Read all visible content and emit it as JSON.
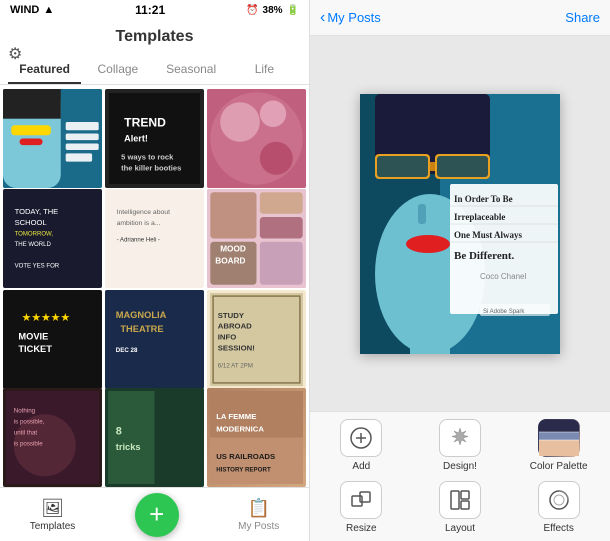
{
  "statusBar": {
    "carrier": "WIND",
    "wifi": true,
    "time": "11:21",
    "battery": "38%"
  },
  "leftPanel": {
    "title": "Templates",
    "tabs": [
      {
        "label": "Featured",
        "active": true
      },
      {
        "label": "Collage",
        "active": false
      },
      {
        "label": "Seasonal",
        "active": false
      },
      {
        "label": "Life",
        "active": false
      }
    ],
    "templates": [
      {
        "id": 1,
        "style": "t1",
        "text": ""
      },
      {
        "id": 2,
        "style": "t2",
        "text": "TREND Alert!"
      },
      {
        "id": 3,
        "style": "t3",
        "text": ""
      },
      {
        "id": 4,
        "style": "t4",
        "text": "5 ways to rock the killer booties"
      },
      {
        "id": 5,
        "style": "t5",
        "text": "Intelligence about ambition"
      },
      {
        "id": 6,
        "style": "t6",
        "text": "MOOD BOARD"
      },
      {
        "id": 7,
        "style": "t7",
        "text": "★★★★★ MOVIE TICKET"
      },
      {
        "id": 8,
        "style": "t8",
        "text": "MAGNOLIA THEATRE"
      },
      {
        "id": 9,
        "style": "t9",
        "text": "STUDY ABROAD INFO SESSION"
      },
      {
        "id": 10,
        "style": "t10",
        "text": ""
      },
      {
        "id": 11,
        "style": "t11",
        "text": "8 tricks"
      },
      {
        "id": 12,
        "style": "t12",
        "text": "LA FEMME MODERNICA"
      }
    ],
    "bottomTabs": [
      {
        "label": "Templates",
        "icon": "🖼",
        "active": true
      },
      {
        "label": "My Posts",
        "icon": "📋",
        "active": false
      }
    ]
  },
  "rightPanel": {
    "backLabel": "My Posts",
    "shareLabel": "Share",
    "quote": {
      "line1": "In Order To Be",
      "line2": "Irreplaceable",
      "line3": "One Must Always",
      "line4": "Be Different.",
      "author": "Coco Chanel",
      "badge": "Adobe Spark"
    },
    "toolbar": {
      "tools": [
        {
          "id": "add",
          "label": "Add",
          "icon": "+"
        },
        {
          "id": "design",
          "label": "Design!",
          "icon": "✦"
        },
        {
          "id": "color-palette",
          "label": "Color Palette",
          "icon": "palette"
        },
        {
          "id": "resize",
          "label": "Resize",
          "icon": "resize"
        },
        {
          "id": "layout",
          "label": "Layout",
          "icon": "layout"
        },
        {
          "id": "effects",
          "label": "Effects",
          "icon": "effects"
        }
      ]
    }
  }
}
